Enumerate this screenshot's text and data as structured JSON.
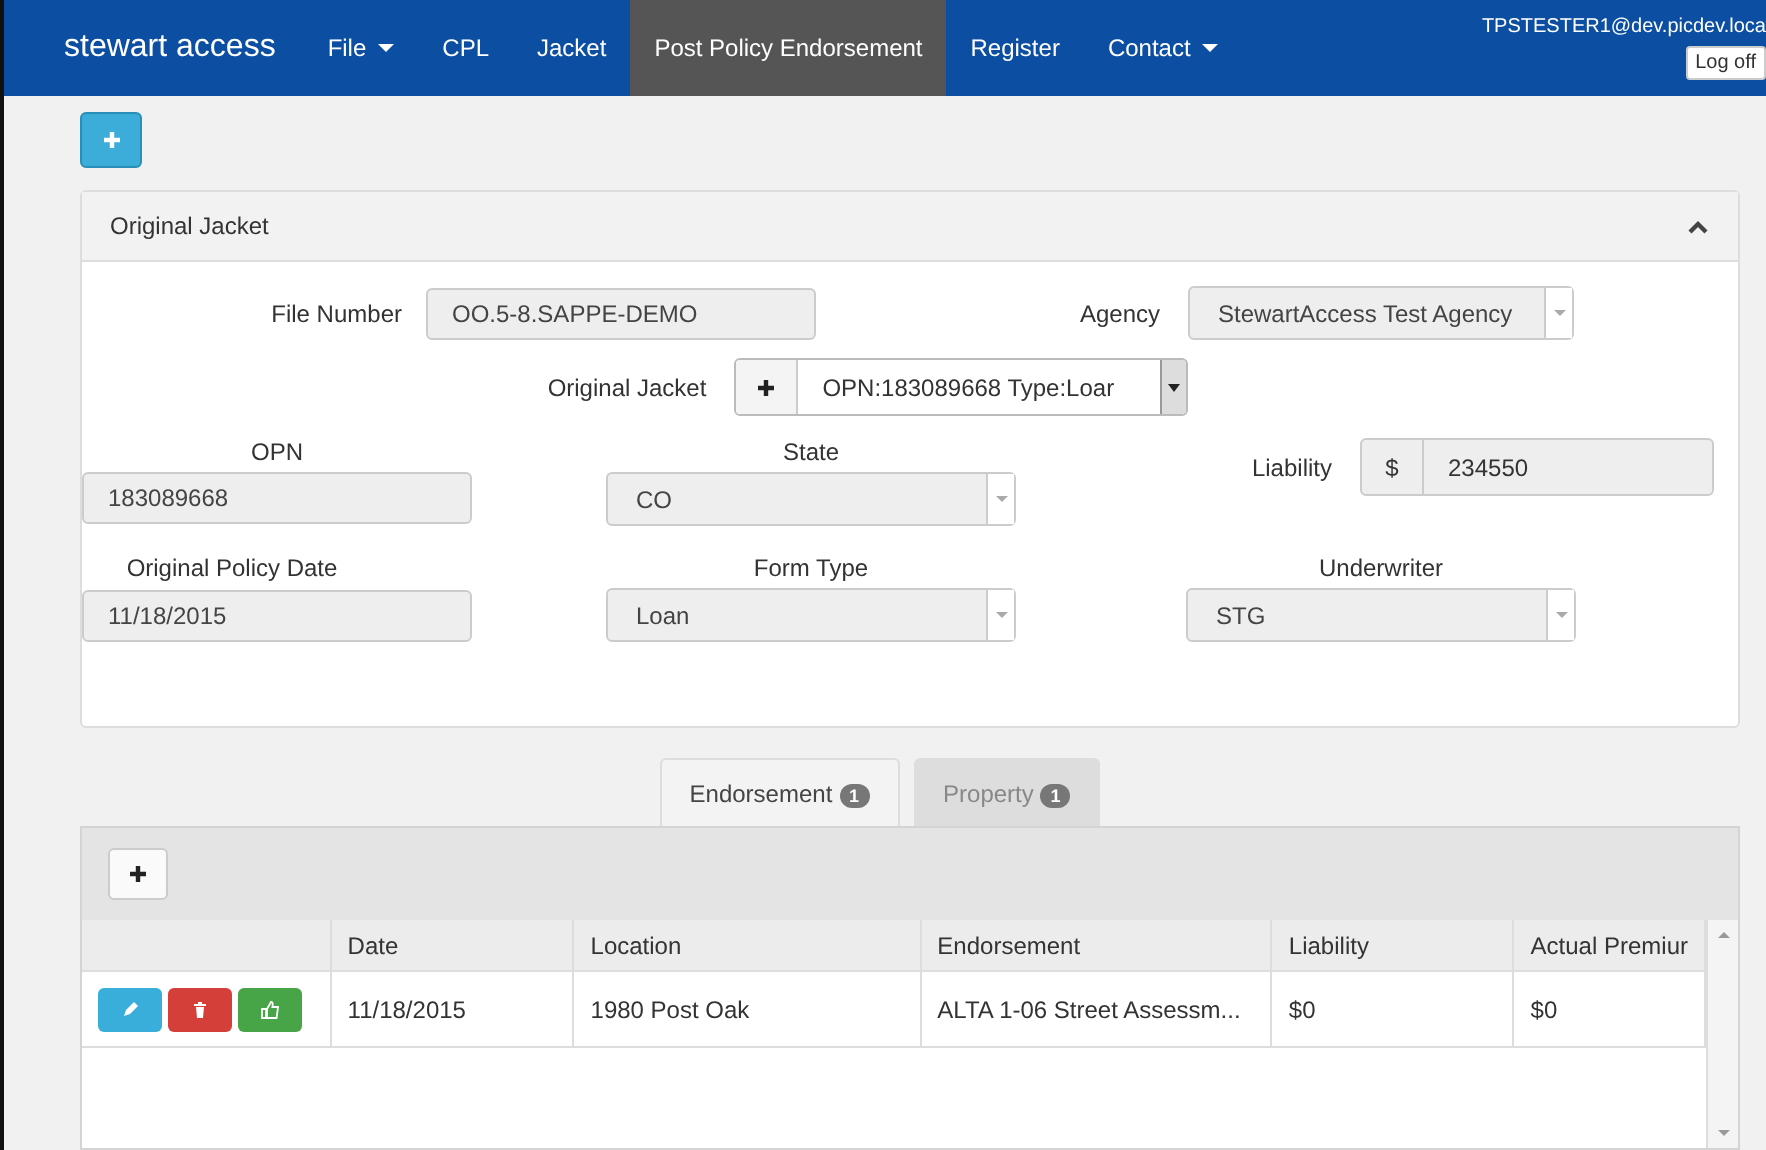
{
  "navbar": {
    "brand": "stewart access",
    "items": [
      {
        "label": "File",
        "dropdown": true,
        "selected": false
      },
      {
        "label": "CPL",
        "dropdown": false,
        "selected": false
      },
      {
        "label": "Jacket",
        "dropdown": false,
        "selected": false
      },
      {
        "label": "Post Policy Endorsement",
        "dropdown": false,
        "selected": true
      },
      {
        "label": "Register",
        "dropdown": false,
        "selected": false
      },
      {
        "label": "Contact",
        "dropdown": true,
        "selected": false
      }
    ],
    "user": "TPSTESTER1@dev.picdev.loca",
    "logoff": "Log off"
  },
  "panel": {
    "title": "Original Jacket",
    "expanded": true,
    "file_number": {
      "label": "File Number",
      "value": "OO.5-8.SAPPE-DEMO"
    },
    "agency": {
      "label": "Agency",
      "value": "StewartAccess Test Agency"
    },
    "original_jacket": {
      "label": "Original Jacket",
      "value": "OPN:183089668 Type:Loar"
    },
    "opn": {
      "label": "OPN",
      "value": "183089668"
    },
    "state": {
      "label": "State",
      "value": "CO"
    },
    "liability": {
      "label": "Liability",
      "prefix": "$",
      "value": "234550"
    },
    "policy_date": {
      "label": "Original Policy Date",
      "value": "11/18/2015"
    },
    "form_type": {
      "label": "Form Type",
      "value": "Loan"
    },
    "underwriter": {
      "label": "Underwriter",
      "value": "STG"
    }
  },
  "tabs": [
    {
      "label": "Endorsement",
      "count": "1",
      "selected": true
    },
    {
      "label": "Property",
      "count": "1",
      "selected": false
    }
  ],
  "table": {
    "columns": [
      "Date",
      "Location",
      "Endorsement",
      "Liability",
      "Actual Premiur"
    ],
    "rows": [
      {
        "cells": [
          "11/18/2015",
          "1980 Post Oak",
          "ALTA 1-06 Street Assessm...",
          "$0",
          "$0"
        ]
      }
    ]
  }
}
